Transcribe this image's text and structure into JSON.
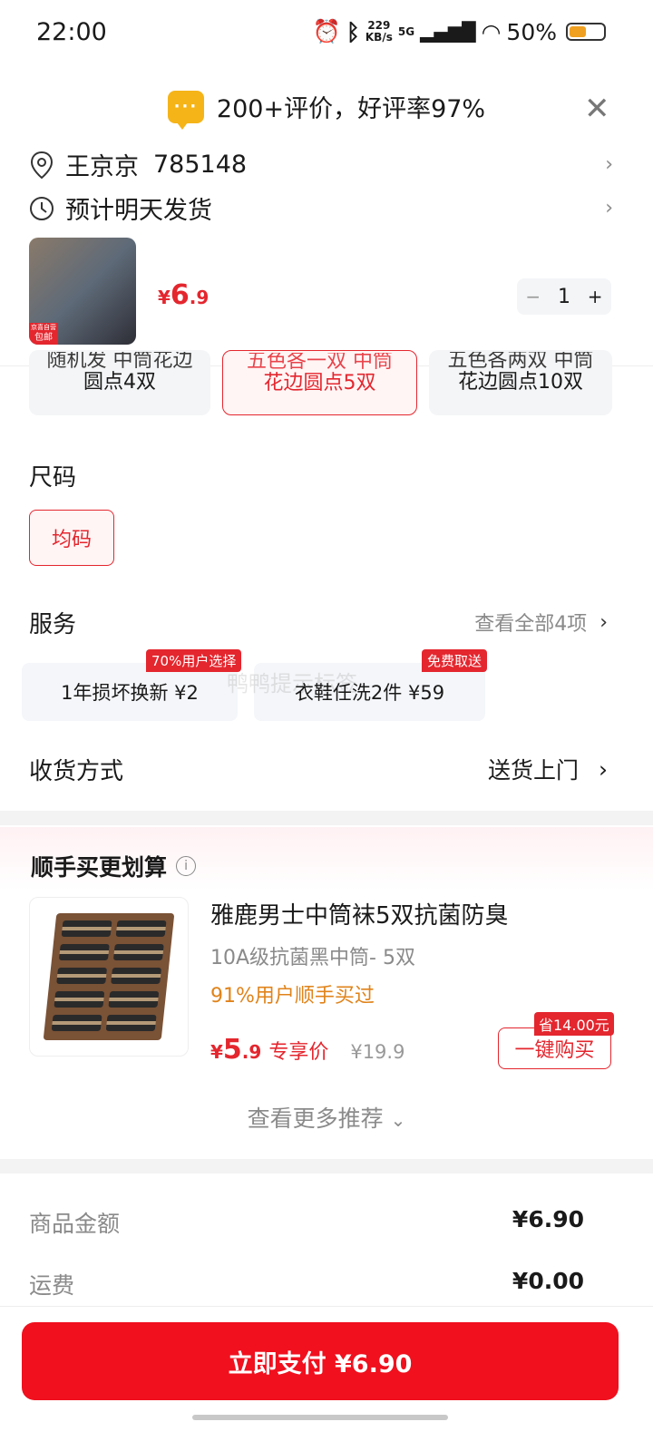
{
  "status_bar": {
    "time": "22:00",
    "net_speed": "229",
    "net_unit": "KB/s",
    "network": "5G",
    "battery": "50%"
  },
  "header": {
    "reviews": "200+评价，好评率97%"
  },
  "address": {
    "name": "王京京",
    "code": "785148"
  },
  "shipping": {
    "text": "预计明天发货"
  },
  "product": {
    "thumb_badge_top": "京喜自营",
    "thumb_badge": "包邮",
    "price_symbol": "¥",
    "price_int": "6",
    "price_dec": ".9",
    "quantity": "1"
  },
  "color_options": [
    {
      "line1": "随机发 中筒花边",
      "line2": "圆点4双"
    },
    {
      "line1": "五色各一双 中筒",
      "line2": "花边圆点5双"
    },
    {
      "line1": "五色各两双 中筒",
      "line2": "花边圆点10双"
    }
  ],
  "size": {
    "title": "尺码",
    "option": "均码"
  },
  "services": {
    "title": "服务",
    "view_all": "查看全部4项",
    "items": [
      {
        "label": "1年损坏换新  ¥2",
        "tag": "70%用户选择"
      },
      {
        "label": "衣鞋任洗2件  ¥59",
        "tag": "免费取送"
      }
    ]
  },
  "delivery": {
    "title": "收货方式",
    "value": "送货上门"
  },
  "recommend": {
    "title": "顺手买更划算",
    "name": "雅鹿男士中筒袜5双抗菌防臭",
    "spec": "10A级抗菌黑中筒- 5双",
    "tag": "91%用户顺手买过",
    "price_int": "5",
    "price_dec": ".9",
    "price_label": "专享价",
    "original_price": "¥19.9",
    "save": "省14.00元",
    "buy": "一键购买",
    "more": "查看更多推荐"
  },
  "summary": [
    {
      "label": "商品金额",
      "value": "¥6.90"
    },
    {
      "label": "运费",
      "value": "¥0.00"
    }
  ],
  "pay_button": "立即支付 ¥6.90",
  "watermark": "鸭鸭提示标签",
  "colors": {
    "accent": "#e4262e",
    "pay": "#f0101e"
  }
}
